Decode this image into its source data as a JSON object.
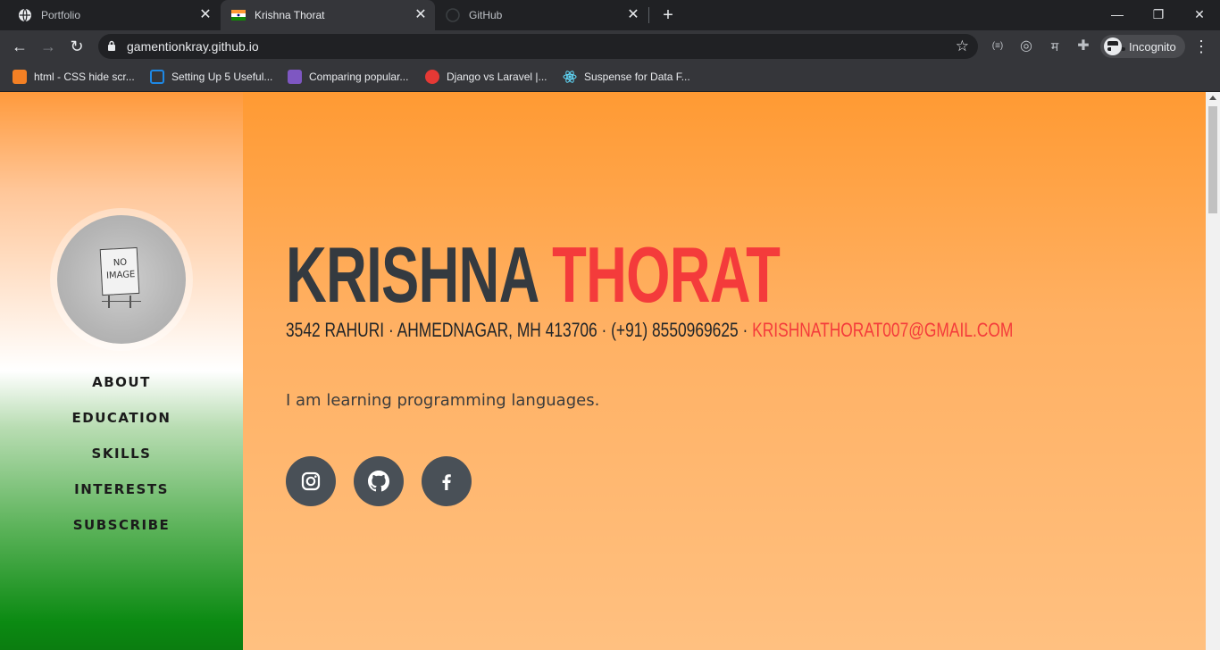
{
  "browser": {
    "tabs": [
      {
        "label": "Portfolio",
        "icon": "globe-icon",
        "active": false
      },
      {
        "label": "Krishna Thorat",
        "icon": "india-flag-icon",
        "active": true
      },
      {
        "label": "GitHub",
        "icon": "github-icon",
        "active": false
      }
    ],
    "close_glyph": "✕",
    "new_tab_glyph": "+",
    "window": {
      "minimize": "—",
      "restore": "❐",
      "close": "✕"
    },
    "nav": {
      "back": "←",
      "forward": "→",
      "reload": "↻"
    },
    "url": "gamentionkray.github.io",
    "star_glyph": "☆",
    "extensions": {
      "ext1": "(≡)",
      "ext2": "◎",
      "ext3": "म",
      "ext4": "✚"
    },
    "incognito_label": "Incognito",
    "menu_glyph": "⋮",
    "bookmarks": [
      {
        "label": "html - CSS hide scr...",
        "icon": "stackoverflow-icon",
        "color": "#f48024"
      },
      {
        "label": "Setting Up 5 Useful...",
        "icon": "bookmark-doc-icon",
        "color": "#1e88e5"
      },
      {
        "label": "Comparing popular...",
        "icon": "rocket-icon",
        "color": "#7e57c2"
      },
      {
        "label": "Django vs Laravel |...",
        "icon": "edureka-icon",
        "color": "#e53935"
      },
      {
        "label": "Suspense for Data F...",
        "icon": "react-icon",
        "color": "#61dafb"
      }
    ]
  },
  "sidebar": {
    "avatar_text_1": "NO",
    "avatar_text_2": "IMAGE",
    "nav": [
      "ABOUT",
      "EDUCATION",
      "SKILLS",
      "INTERESTS",
      "SUBSCRIBE"
    ]
  },
  "profile": {
    "first_name": "KRISHNA",
    "last_name": "THORAT",
    "contact_text": "3542 RAHURI · AHMEDNAGAR, MH 413706 · (+91) 8550969625 · ",
    "email": "KRISHNATHORAT007@GMAIL.COM",
    "tagline": "I am learning programming languages.",
    "social": [
      {
        "icon": "instagram-icon"
      },
      {
        "icon": "github-icon"
      },
      {
        "icon": "facebook-icon"
      }
    ]
  },
  "colors": {
    "accent": "#f43b3b",
    "dark": "#343a40",
    "social_bg": "#495057"
  }
}
